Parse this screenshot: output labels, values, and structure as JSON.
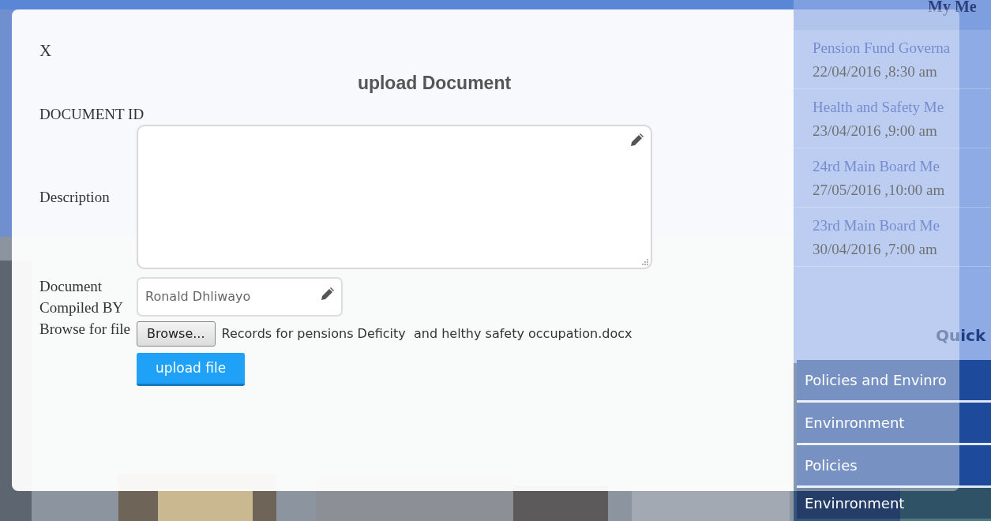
{
  "sidebar": {
    "heading": "My Me",
    "meetings": [
      {
        "title": "Pension Fund Governa",
        "when": "22/04/2016 ,8:30 am"
      },
      {
        "title": "Health and Safety Me",
        "when": "23/04/2016 ,9:00 am"
      },
      {
        "title": "24rd Main Board Me",
        "when": "27/05/2016 ,10:00 am"
      },
      {
        "title": "23rd Main Board Me",
        "when": "30/04/2016 ,7:00 am"
      }
    ],
    "quick_heading": "Quick",
    "links": [
      "Policies and Envinro",
      "Envinronment",
      "Policies",
      "Envinronment"
    ]
  },
  "modal": {
    "close": "X",
    "title": "upload Document",
    "document_id_label": "DOCUMENT ID",
    "description": {
      "label": "Description"
    },
    "compiled_by": {
      "label": "Document Compiled BY",
      "placeholder": "Ronald Dhliwayo"
    },
    "file": {
      "label": "Browse for file",
      "button": "Browse...",
      "filename": "Records for pensions Deficity  and helthy safety occupation.docx"
    },
    "submit": "upload file"
  }
}
